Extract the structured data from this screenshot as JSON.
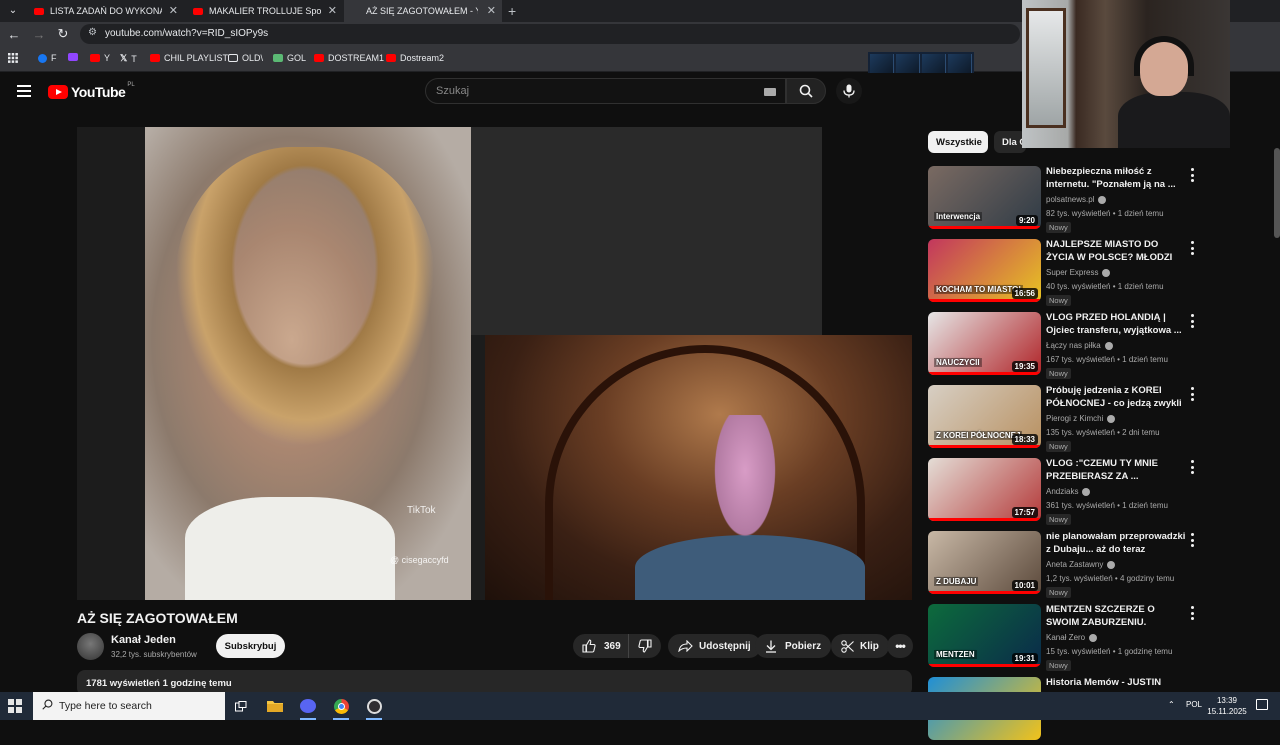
{
  "browser": {
    "tabs": [
      {
        "label": "LISTA ZADAŃ DO WYKONANIA"
      },
      {
        "label": "MAKALIER TROLLUJE Spotkanie"
      },
      {
        "label": "AŻ SIĘ ZAGOTOWAŁEM - YouTube"
      }
    ],
    "url": "youtube.com/watch?v=RID_sIOPy9s",
    "bookmarks": [
      {
        "label": "F",
        "color": "#1877f2"
      },
      {
        "label": "",
        "color": "#9146ff"
      },
      {
        "label": "Y",
        "color": "#ff0000"
      },
      {
        "label": "T",
        "color": "#ffffff"
      },
      {
        "label": "CHIL PLAYLIST",
        "color": "#ff0000"
      },
      {
        "label": "OLD\\",
        "color": "#e8eaed"
      },
      {
        "label": "GOL",
        "color": "#5bb974"
      },
      {
        "label": "DOSTREAM1",
        "color": "#ff0000"
      },
      {
        "label": "Dostream2",
        "color": "#ff0000"
      }
    ]
  },
  "youtube": {
    "logo_text": "YouTube",
    "region": "PL",
    "search_placeholder": "Szukaj"
  },
  "video": {
    "title": "AŻ SIĘ ZAGOTOWAŁEM",
    "channel": "Kanał Jeden",
    "subscribers": "32,2 tys. subskrybentów",
    "subscribe_label": "Subskrybuj",
    "likes": "369",
    "share_label": "Udostępnij",
    "download_label": "Pobierz",
    "clip_label": "Klip",
    "views_line": "1781 wyświetleń  1 godzinę temu",
    "overlay_brand": "TikTok",
    "overlay_handle": "@ cisegaccyfd"
  },
  "sidebar": {
    "chips": [
      {
        "label": "Wszystkie"
      },
      {
        "label": "Dla C"
      }
    ],
    "recommendations": [
      {
        "title": "Niebezpieczna miłość z internetu. \"Poznałem ją na ...",
        "channel": "polsatnews.pl",
        "meta": "82 tys. wyświetleń • 1 dzień temu",
        "badge": "Nowy",
        "duration": "9:20",
        "thumb_overlay": "Interwencja",
        "colors": [
          "#7a6a62",
          "#2f3b46"
        ]
      },
      {
        "title": "NAJLEPSZE MIASTO DO ŻYCIA W POLSCE? MŁODZI TU ...",
        "channel": "Super Express",
        "meta": "40 tys. wyświetleń • 1 dzień temu",
        "badge": "Nowy",
        "duration": "16:56",
        "thumb_overlay": "KOCHAM TO MIASTO!",
        "colors": [
          "#c2365e",
          "#e8c422"
        ]
      },
      {
        "title": "VLOG PRZED HOLANDIĄ | Ojciec transferu, wyjątkowa ...",
        "channel": "Łączy nas piłka",
        "meta": "167 tys. wyświetleń • 1 dzień temu",
        "badge": "Nowy",
        "duration": "19:35",
        "thumb_overlay": "NAUCZYCII",
        "colors": [
          "#e6e6e6",
          "#b02428"
        ]
      },
      {
        "title": "Próbuję jedzenia z KOREI PÓŁNOCNEJ - co jedzą zwykli ...",
        "channel": "Pierogi z Kimchi",
        "meta": "135 tys. wyświetleń • 2 dni temu",
        "badge": "Nowy",
        "duration": "18:33",
        "thumb_overlay": "Z KOREI PÓŁNOCNEJ",
        "colors": [
          "#d7cfc4",
          "#b89060"
        ]
      },
      {
        "title": "VLOG :\"CZEMU TY MNIE PRZEBIERASZ ZA ...",
        "channel": "Andziaks",
        "meta": "361 tys. wyświetleń • 1 dzień temu",
        "badge": "Nowy",
        "duration": "17:57",
        "thumb_overlay": "",
        "colors": [
          "#e4ddd6",
          "#b43a3a"
        ]
      },
      {
        "title": "nie planowałam przeprowadzki z Dubaju... aż do teraz",
        "channel": "Aneta Zastawny",
        "meta": "1,2 tys. wyświetleń • 4 godziny temu",
        "badge": "Nowy",
        "duration": "10:01",
        "thumb_overlay": "Z DUBAJU",
        "colors": [
          "#c8b8a6",
          "#5c4a3c"
        ]
      },
      {
        "title": "MENTZEN SZCZERZE O SWOIM ZABURZENIU. DIAGNOZA, ...",
        "channel": "Kanał Zero",
        "meta": "15 tys. wyświetleń • 1 godzinę temu",
        "badge": "Nowy",
        "duration": "19:31",
        "thumb_overlay": "MENTZEN",
        "colors": [
          "#0d6b3c",
          "#0a2a4a"
        ]
      },
      {
        "title": "Historia Memów - JUSTIN",
        "channel": "",
        "meta": "",
        "badge": "",
        "duration": "",
        "thumb_overlay": "",
        "colors": [
          "#1f8fd6",
          "#f2c21a"
        ]
      }
    ]
  },
  "taskbar": {
    "search_placeholder": "Type here to search",
    "language": "POL",
    "time": "13:39",
    "date": "15.11.2025"
  }
}
